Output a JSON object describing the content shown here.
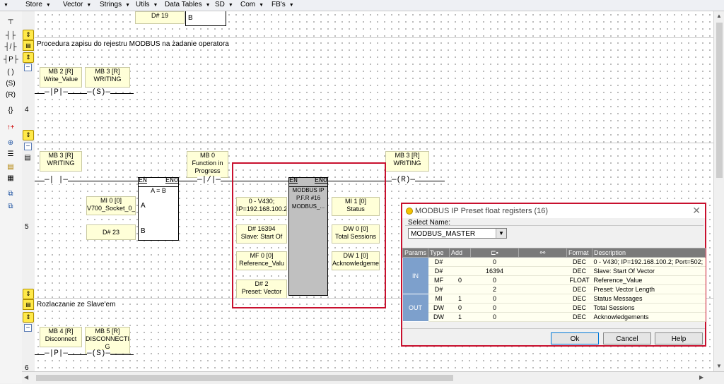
{
  "menu": {
    "items": [
      "Store",
      "Vector",
      "Strings",
      "Utils",
      "Data Tables",
      "SD",
      "Com",
      "FB's"
    ],
    "arrow_glyph": "▼"
  },
  "ladder": {
    "top_fragment": {
      "op_label": "D# 19",
      "pin": "B"
    },
    "rung4": {
      "comment": "Procedura zapisu do rejestru MODBUS na żadanie operatora",
      "number": "4",
      "op1": {
        "line1": "MB 2 [R]",
        "line2": "Write_Value"
      },
      "op2": {
        "line1": "MB 3 [R]",
        "line2": "WRITING"
      },
      "contact_p": "—|P|—",
      "coil_s": "—(S)—"
    },
    "rung5": {
      "number": "5",
      "op_writing": {
        "line1": "MB 3 [R]",
        "line2": "WRITING"
      },
      "op_mb0": {
        "line1": "MB 0",
        "line2": "Function in",
        "line3": "Progress"
      },
      "op_coil": {
        "line1": "MB 3 [R]",
        "line2": "WRITING"
      },
      "contact_no": "—| |—",
      "contact_nc": "—|/|—",
      "coil_r": "—(R)—",
      "compare_block": {
        "en": "EN",
        "eno": "ENO",
        "name": "A = B",
        "pin_a": "A",
        "pin_b": "B"
      },
      "op_mi0": {
        "line1": "MI 0 [0]",
        "line2": "V700_Socket_0_"
      },
      "op_d23": {
        "line1": "D# 23"
      },
      "modbus_block": {
        "en": "EN",
        "eno": "ENO",
        "line1": "MODBUS IP",
        "line2": "P.F.R #16",
        "line3": "MODBUS_..."
      },
      "in1": {
        "line1": "0 - V430;",
        "line2": "IP=192.168.100.2"
      },
      "in2": {
        "line1": "D# 16394",
        "line2": "Slave: Start Of"
      },
      "in3": {
        "line1": "MF 0 [0]",
        "line2": "Reference_Valu"
      },
      "in4": {
        "line1": "D# 2",
        "line2": "Preset: Vector"
      },
      "out1": {
        "line1": "MI 1 [0]",
        "line2": "Status"
      },
      "out2": {
        "line1": "DW 0 [0]",
        "line2": "Total Sessions"
      },
      "out3": {
        "line1": "DW 1 [0]",
        "line2": "Acknowledgeme"
      }
    },
    "rung6": {
      "comment": "Rozlaczanie ze Slave'em",
      "number": "6",
      "op1": {
        "line1": "MB 4 [R]",
        "line2": "Disconnect"
      },
      "op2": {
        "line1": "MB 5 [R]",
        "line2": "DISCONNECTIN",
        "line3": "G"
      },
      "contact_p": "—|P|—",
      "coil_s": "—(S)—"
    }
  },
  "dialog": {
    "title": "MODBUS IP Preset float registers (16)",
    "close": "✕",
    "select_label": "Select Name:",
    "select_value": "MODBUS_MASTER",
    "select_arrow": "▼",
    "columns": [
      "Params",
      "Type",
      "Add",
      "",
      "",
      "Format",
      "Description"
    ],
    "icons": {
      "col4": "plug-icon",
      "col5": "link-icon"
    },
    "group_in": "IN",
    "group_out": "OUT",
    "rows": [
      {
        "type": "D#",
        "add": "",
        "v1": "0",
        "v2": "",
        "format": "DEC",
        "desc": "0 - V430; IP=192.168.100.2; Port=502;"
      },
      {
        "type": "D#",
        "add": "",
        "v1": "16394",
        "v2": "",
        "format": "DEC",
        "desc": "Slave: Start Of Vector"
      },
      {
        "type": "MF",
        "add": "0",
        "v1": "0",
        "v2": "",
        "format": "FLOAT",
        "desc": "Reference_Value"
      },
      {
        "type": "D#",
        "add": "",
        "v1": "2",
        "v2": "",
        "format": "DEC",
        "desc": "Preset: Vector Length"
      },
      {
        "type": "MI",
        "add": "1",
        "v1": "0",
        "v2": "",
        "format": "DEC",
        "desc": "Status Messages"
      },
      {
        "type": "DW",
        "add": "0",
        "v1": "0",
        "v2": "",
        "format": "DEC",
        "desc": "Total Sessions"
      },
      {
        "type": "DW",
        "add": "1",
        "v1": "0",
        "v2": "",
        "format": "DEC",
        "desc": "Acknowledgements"
      }
    ],
    "buttons": {
      "ok": "Ok",
      "cancel": "Cancel",
      "help": "Help"
    }
  }
}
